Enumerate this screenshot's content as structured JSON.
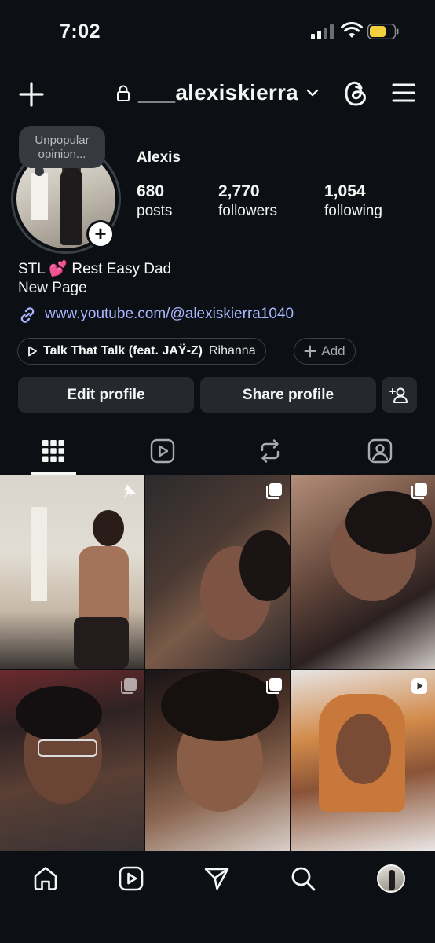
{
  "status_bar": {
    "time": "7:02"
  },
  "header": {
    "username": "___alexiskierra"
  },
  "profile": {
    "note": "Unpopular opinion...",
    "display_name": "Alexis",
    "stats": [
      {
        "value": "680",
        "label": "posts"
      },
      {
        "value": "2,770",
        "label": "followers"
      },
      {
        "value": "1,054",
        "label": "following"
      }
    ],
    "bio_line1": "STL 💕 Rest Easy Dad",
    "bio_line2": "New Page",
    "link": "www.youtube.com/@alexiskierra1040",
    "music": {
      "song": "Talk That Talk (feat. JAŸ-Z)",
      "artist": "Rihanna"
    },
    "add_label": "Add"
  },
  "actions": {
    "edit": "Edit profile",
    "share": "Share profile"
  },
  "tabs": [
    "grid-icon",
    "reels-icon",
    "reposts-icon",
    "tagged-icon"
  ],
  "posts": [
    {
      "type": "pinned"
    },
    {
      "type": "carousel"
    },
    {
      "type": "carousel"
    },
    {
      "type": "carousel"
    },
    {
      "type": "carousel"
    },
    {
      "type": "reel"
    }
  ],
  "bottom_nav": [
    "home-icon",
    "reels-icon",
    "send-icon",
    "search-icon",
    "profile-avatar"
  ],
  "colors": {
    "background": "#0c1014",
    "button": "#25292e",
    "link": "#a9b6ff",
    "battery": "#f4d03f"
  }
}
